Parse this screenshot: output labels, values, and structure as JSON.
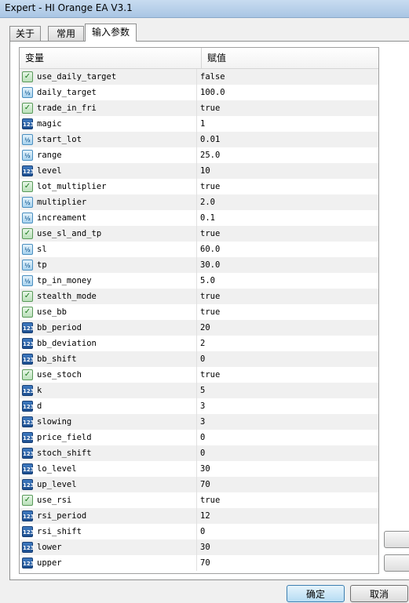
{
  "window": {
    "title": "Expert - HI Orange EA V3.1"
  },
  "tabs": [
    {
      "label": "关于"
    },
    {
      "label": "常用"
    },
    {
      "label": "输入参数"
    }
  ],
  "grid": {
    "col_variable": "变量",
    "col_value": "赋值",
    "rows": [
      {
        "type": "bool",
        "name": "use_daily_target",
        "value": "false"
      },
      {
        "type": "double",
        "name": "daily_target",
        "value": "100.0"
      },
      {
        "type": "bool",
        "name": "trade_in_fri",
        "value": "true"
      },
      {
        "type": "int",
        "name": "magic",
        "value": "1"
      },
      {
        "type": "double",
        "name": "start_lot",
        "value": "0.01"
      },
      {
        "type": "double",
        "name": "range",
        "value": "25.0"
      },
      {
        "type": "int",
        "name": "level",
        "value": "10"
      },
      {
        "type": "bool",
        "name": "lot_multiplier",
        "value": "true"
      },
      {
        "type": "double",
        "name": "multiplier",
        "value": "2.0"
      },
      {
        "type": "double",
        "name": "increament",
        "value": "0.1"
      },
      {
        "type": "bool",
        "name": "use_sl_and_tp",
        "value": "true"
      },
      {
        "type": "double",
        "name": "sl",
        "value": "60.0"
      },
      {
        "type": "double",
        "name": "tp",
        "value": "30.0"
      },
      {
        "type": "double",
        "name": "tp_in_money",
        "value": "5.0"
      },
      {
        "type": "bool",
        "name": "stealth_mode",
        "value": "true"
      },
      {
        "type": "bool",
        "name": "use_bb",
        "value": "true"
      },
      {
        "type": "int",
        "name": "bb_period",
        "value": "20"
      },
      {
        "type": "int",
        "name": "bb_deviation",
        "value": "2"
      },
      {
        "type": "int",
        "name": "bb_shift",
        "value": "0"
      },
      {
        "type": "bool",
        "name": "use_stoch",
        "value": "true"
      },
      {
        "type": "int",
        "name": "k",
        "value": "5"
      },
      {
        "type": "int",
        "name": "d",
        "value": "3"
      },
      {
        "type": "int",
        "name": "slowing",
        "value": "3"
      },
      {
        "type": "int",
        "name": "price_field",
        "value": "0"
      },
      {
        "type": "int",
        "name": "stoch_shift",
        "value": "0"
      },
      {
        "type": "int",
        "name": "lo_level",
        "value": "30"
      },
      {
        "type": "int",
        "name": "up_level",
        "value": "70"
      },
      {
        "type": "bool",
        "name": "use_rsi",
        "value": "true"
      },
      {
        "type": "int",
        "name": "rsi_period",
        "value": "12"
      },
      {
        "type": "int",
        "name": "rsi_shift",
        "value": "0"
      },
      {
        "type": "int",
        "name": "lower",
        "value": "30"
      },
      {
        "type": "int",
        "name": "upper",
        "value": "70"
      }
    ]
  },
  "icons": {
    "bool": "checkmark-icon",
    "double": "half-icon",
    "int": "123-icon"
  },
  "icon_text": {
    "double": "½",
    "int": "123"
  },
  "footer": {
    "ok_label": "确定",
    "cancel_label": "取消"
  }
}
